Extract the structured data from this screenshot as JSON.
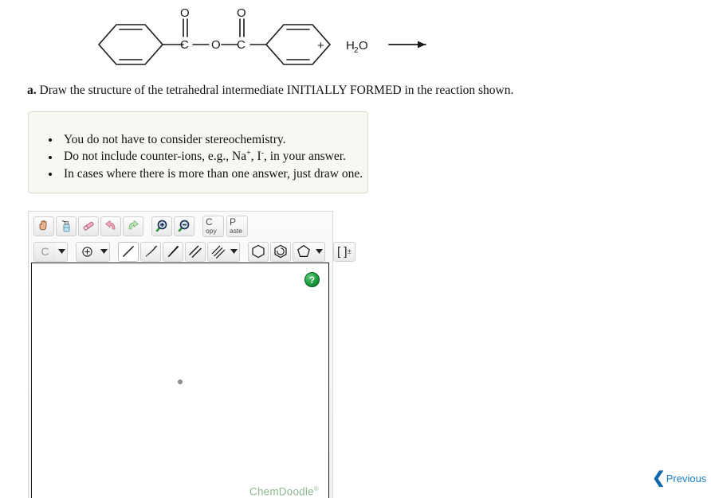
{
  "reaction": {
    "name": "benzoic-anhydride-hydrolysis",
    "reactant_label": "benzoic anhydride",
    "atoms": {
      "oxygen": "O",
      "carbon": "C",
      "water": "H",
      "water_sub": "2",
      "water_o": "O"
    },
    "plus": "+",
    "water_formula": "H2O",
    "arrow": "reaction-arrow"
  },
  "prompt": {
    "lead": "a.",
    "text": "Draw the structure of the tetrahedral intermediate INITIALLY FORMED in the reaction shown."
  },
  "notes": {
    "items": [
      {
        "pre": "You do not have to consider stereochemistry.",
        "sup1": "",
        "mid": "",
        "sup2": "",
        "post": ""
      },
      {
        "pre": "Do not include counter-ions, e.g., Na",
        "sup1": "+",
        "mid": ", I",
        "sup2": "-",
        "post": ", in your answer."
      },
      {
        "pre": "In cases where there is more than one answer, just draw one.",
        "sup1": "",
        "mid": "",
        "sup2": "",
        "post": ""
      }
    ]
  },
  "sketcher": {
    "toolbar_row1": [
      {
        "name": "pan-hand-tool",
        "title": "Move / pan"
      },
      {
        "name": "clear-tool",
        "title": "Clear"
      },
      {
        "name": "eraser-tool",
        "title": "Erase"
      },
      {
        "name": "undo-tool",
        "title": "Undo"
      },
      {
        "name": "redo-tool",
        "title": "Redo"
      },
      {
        "name": "zoom-in-tool",
        "title": "Zoom in"
      },
      {
        "name": "zoom-out-tool",
        "title": "Zoom out"
      }
    ],
    "copy_button": {
      "big": "C",
      "small": "opy"
    },
    "paste_button": {
      "big": "P",
      "small": "aste"
    },
    "element_button": {
      "label": "C",
      "name": "element-carbon-button"
    },
    "charge_button": {
      "label": "charge",
      "name": "charge-tool"
    },
    "bond_tools": [
      {
        "name": "single-bond-tool",
        "selected": true
      },
      {
        "name": "hashed-wedge-bond-tool",
        "selected": false
      },
      {
        "name": "solid-wedge-bond-tool",
        "selected": false
      },
      {
        "name": "double-bond-tool",
        "selected": false
      },
      {
        "name": "triple-bond-tool",
        "selected": false
      }
    ],
    "ring_tools": [
      {
        "name": "cyclohexane-ring-tool"
      },
      {
        "name": "benzene-ring-tool"
      },
      {
        "name": "cyclopentane-ring-tool"
      }
    ],
    "bracket_tool": {
      "label": "[ ]",
      "sup": "±",
      "name": "bracket-charge-tool"
    },
    "help_button": {
      "label": "?"
    },
    "watermark": {
      "text": "ChemDoodle",
      "sup": "®"
    }
  },
  "footer": {
    "previous": {
      "chevron": "❮",
      "label": "Previous"
    }
  },
  "colors": {
    "accent_link": "#1b7ec2",
    "help_green": "#1a9e3f",
    "watermark_green": "#8db98d",
    "note_bg": "#f8f8f3",
    "note_border": "#dedacd"
  }
}
